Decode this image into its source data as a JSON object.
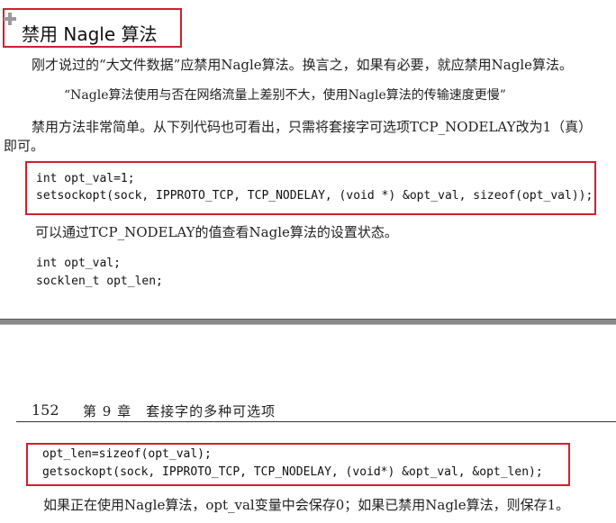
{
  "section": {
    "heading": "禁用 Nagle 算法",
    "icon": "plus-icon"
  },
  "paragraphs": {
    "p1": "刚才说过的“大文件数据”应禁用Nagle算法。换言之，如果有必要，就应禁用Nagle算法。",
    "quote": "“Nagle算法使用与否在网络流量上差别不大，使用Nagle算法的传输速度更慢”",
    "p2_line1": "禁用方法非常简单。从下列代码也可看出，只需将套接字可选项TCP_NODELAY改为1（真）",
    "p2_line2": "即可。",
    "p3": "可以通过TCP_NODELAY的值查看Nagle算法的设置状态。",
    "p4": "如果正在使用Nagle算法，opt_val变量中会保存0；如果已禁用Nagle算法，则保存1。"
  },
  "code": {
    "block1": [
      "int opt_val=1;",
      "setsockopt(sock, IPPROTO_TCP, TCP_NODELAY, (void *) &opt_val, sizeof(opt_val));"
    ],
    "block2": [
      "int opt_val;",
      "socklen_t opt_len;"
    ],
    "block3": [
      "opt_len=sizeof(opt_val);",
      "getsockopt(sock, IPPROTO_TCP, TCP_NODELAY, (void*) &opt_val, &opt_len);"
    ]
  },
  "page_header": {
    "page_number": "152",
    "chapter": "第 9 章　套接字的多种可选项"
  },
  "colors": {
    "highlight_border": "#d0202e",
    "separator": "#8a8a8a"
  }
}
